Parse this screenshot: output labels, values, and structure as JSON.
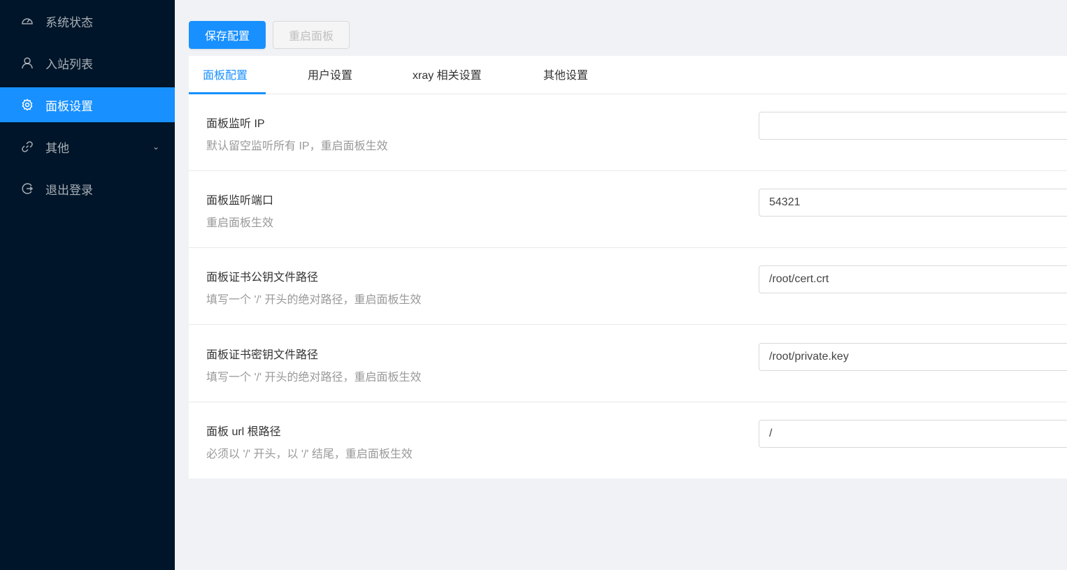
{
  "sidebar": {
    "items": [
      {
        "label": "系统状态",
        "icon": "dashboard-icon"
      },
      {
        "label": "入站列表",
        "icon": "user-icon"
      },
      {
        "label": "面板设置",
        "icon": "gear-icon",
        "active": true
      },
      {
        "label": "其他",
        "icon": "link-icon",
        "has_submenu": true
      },
      {
        "label": "退出登录",
        "icon": "logout-icon"
      }
    ]
  },
  "toolbar": {
    "save_label": "保存配置",
    "restart_label": "重启面板"
  },
  "tabs": [
    "面板配置",
    "用户设置",
    "xray 相关设置",
    "其他设置"
  ],
  "settings": [
    {
      "title": "面板监听 IP",
      "desc": "默认留空监听所有 IP，重启面板生效",
      "value": ""
    },
    {
      "title": "面板监听端口",
      "desc": "重启面板生效",
      "value": "54321"
    },
    {
      "title": "面板证书公钥文件路径",
      "desc": "填写一个 '/' 开头的绝对路径，重启面板生效",
      "value": "/root/cert.crt"
    },
    {
      "title": "面板证书密钥文件路径",
      "desc": "填写一个 '/' 开头的绝对路径，重启面板生效",
      "value": "/root/private.key"
    },
    {
      "title": "面板 url 根路径",
      "desc": "必须以 '/' 开头，以 '/' 结尾，重启面板生效",
      "value": "/"
    }
  ],
  "colors": {
    "primary": "#1890ff",
    "sidebar": "#001529"
  }
}
